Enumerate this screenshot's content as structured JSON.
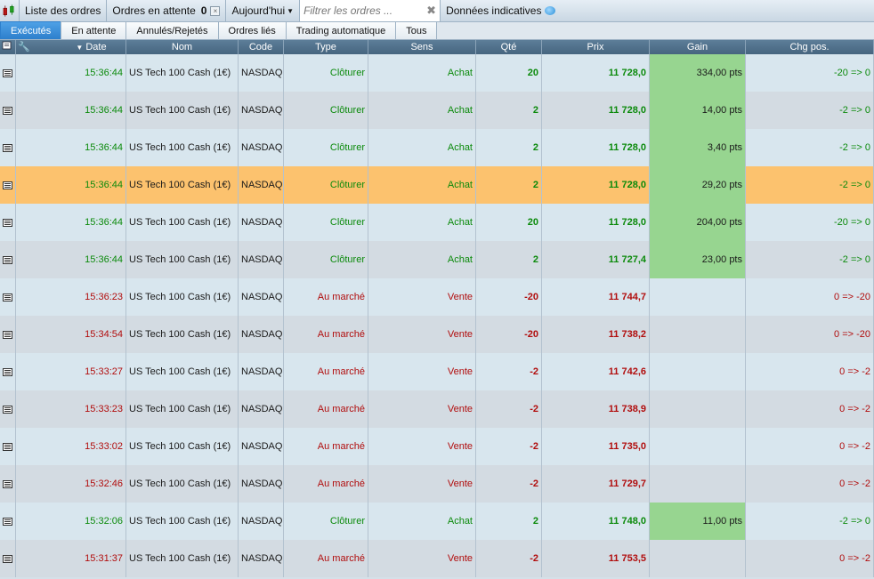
{
  "toolbar": {
    "orders_list_label": "Liste des ordres",
    "pending_label": "Ordres en attente",
    "pending_count": "0",
    "period_label": "Aujourd'hui",
    "filter_placeholder": "Filtrer les ordres ...",
    "indicative_label": "Données indicatives"
  },
  "tabs": [
    {
      "label": "Exécutés",
      "active": true
    },
    {
      "label": "En attente"
    },
    {
      "label": "Annulés/Rejetés"
    },
    {
      "label": "Ordres liés"
    },
    {
      "label": "Trading automatique"
    },
    {
      "label": "Tous"
    }
  ],
  "columns": {
    "date": "Date",
    "nom": "Nom",
    "code": "Code",
    "type": "Type",
    "sens": "Sens",
    "qte": "Qté",
    "prix": "Prix",
    "gain": "Gain",
    "chg": "Chg pos."
  },
  "colors": {
    "buy": "#0b8a0b",
    "sell": "#b10d0d",
    "gain_bg": "#97d590",
    "selected_row": "#fcc26e",
    "active_tab": "#2d7fcc"
  },
  "rows": [
    {
      "date": "15:36:44",
      "nom": "US Tech 100 Cash (1€)",
      "code": "NASDAQ",
      "type": "Clôturer",
      "sens": "Achat",
      "qte": "20",
      "prix": "11 728,0",
      "gain": "334,00 pts",
      "chg": "-20 => 0"
    },
    {
      "date": "15:36:44",
      "nom": "US Tech 100 Cash (1€)",
      "code": "NASDAQ",
      "type": "Clôturer",
      "sens": "Achat",
      "qte": "2",
      "prix": "11 728,0",
      "gain": "14,00 pts",
      "chg": "-2 => 0"
    },
    {
      "date": "15:36:44",
      "nom": "US Tech 100 Cash (1€)",
      "code": "NASDAQ",
      "type": "Clôturer",
      "sens": "Achat",
      "qte": "2",
      "prix": "11 728,0",
      "gain": "3,40 pts",
      "chg": "-2 => 0"
    },
    {
      "date": "15:36:44",
      "nom": "US Tech 100 Cash (1€)",
      "code": "NASDAQ",
      "type": "Clôturer",
      "sens": "Achat",
      "qte": "2",
      "prix": "11 728,0",
      "gain": "29,20 pts",
      "chg": "-2 => 0",
      "selected": true
    },
    {
      "date": "15:36:44",
      "nom": "US Tech 100 Cash (1€)",
      "code": "NASDAQ",
      "type": "Clôturer",
      "sens": "Achat",
      "qte": "20",
      "prix": "11 728,0",
      "gain": "204,00 pts",
      "chg": "-20 => 0"
    },
    {
      "date": "15:36:44",
      "nom": "US Tech 100 Cash (1€)",
      "code": "NASDAQ",
      "type": "Clôturer",
      "sens": "Achat",
      "qte": "2",
      "prix": "11 727,4",
      "gain": "23,00 pts",
      "chg": "-2 => 0"
    },
    {
      "date": "15:36:23",
      "nom": "US Tech 100 Cash (1€)",
      "code": "NASDAQ",
      "type": "Au marché",
      "sens": "Vente",
      "qte": "-20",
      "prix": "11 744,7",
      "gain": "",
      "chg": "0 => -20"
    },
    {
      "date": "15:34:54",
      "nom": "US Tech 100 Cash (1€)",
      "code": "NASDAQ",
      "type": "Au marché",
      "sens": "Vente",
      "qte": "-20",
      "prix": "11 738,2",
      "gain": "",
      "chg": "0 => -20"
    },
    {
      "date": "15:33:27",
      "nom": "US Tech 100 Cash (1€)",
      "code": "NASDAQ",
      "type": "Au marché",
      "sens": "Vente",
      "qte": "-2",
      "prix": "11 742,6",
      "gain": "",
      "chg": "0 => -2"
    },
    {
      "date": "15:33:23",
      "nom": "US Tech 100 Cash (1€)",
      "code": "NASDAQ",
      "type": "Au marché",
      "sens": "Vente",
      "qte": "-2",
      "prix": "11 738,9",
      "gain": "",
      "chg": "0 => -2"
    },
    {
      "date": "15:33:02",
      "nom": "US Tech 100 Cash (1€)",
      "code": "NASDAQ",
      "type": "Au marché",
      "sens": "Vente",
      "qte": "-2",
      "prix": "11 735,0",
      "gain": "",
      "chg": "0 => -2"
    },
    {
      "date": "15:32:46",
      "nom": "US Tech 100 Cash (1€)",
      "code": "NASDAQ",
      "type": "Au marché",
      "sens": "Vente",
      "qte": "-2",
      "prix": "11 729,7",
      "gain": "",
      "chg": "0 => -2"
    },
    {
      "date": "15:32:06",
      "nom": "US Tech 100 Cash (1€)",
      "code": "NASDAQ",
      "type": "Clôturer",
      "sens": "Achat",
      "qte": "2",
      "prix": "11 748,0",
      "gain": "11,00 pts",
      "chg": "-2 => 0"
    },
    {
      "date": "15:31:37",
      "nom": "US Tech 100 Cash (1€)",
      "code": "NASDAQ",
      "type": "Au marché",
      "sens": "Vente",
      "qte": "-2",
      "prix": "11 753,5",
      "gain": "",
      "chg": "0 => -2"
    }
  ]
}
